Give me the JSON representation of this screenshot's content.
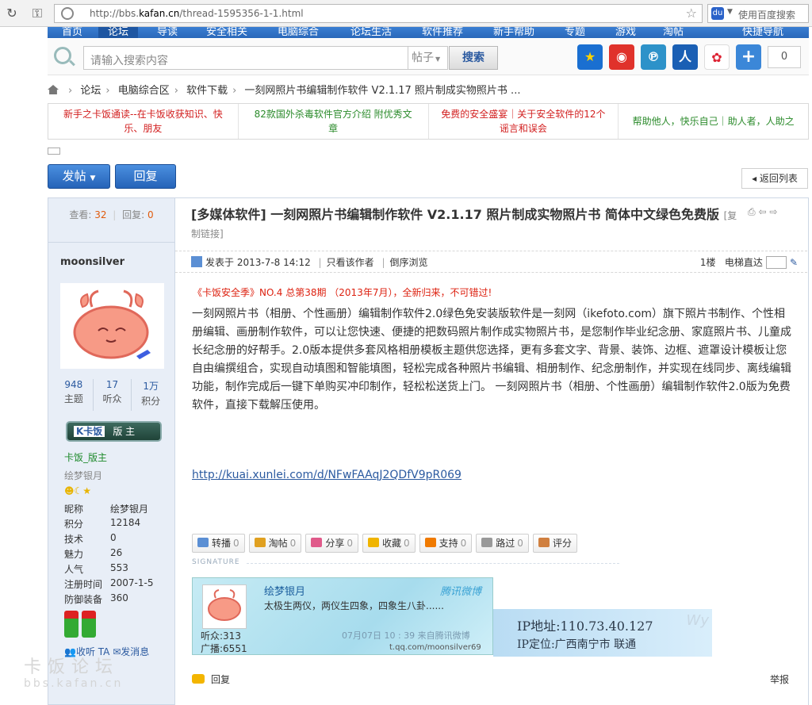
{
  "browser": {
    "url_scheme": "http://bbs.",
    "url_host": "kafan.cn",
    "url_path": "/thread-1595356-1-1.html",
    "search_placeholder": "使用百度搜索"
  },
  "topnav": [
    "首页",
    "论坛",
    "导读",
    "安全相关",
    "电脑综合",
    "论坛生活",
    "软件推荐",
    "新手帮助",
    "专题",
    "游戏",
    "淘帖",
    "快捷导航"
  ],
  "site_search": {
    "placeholder": "请输入搜索内容",
    "type": "帖子",
    "button": "搜索",
    "share_count": "0"
  },
  "breadcrumb": [
    "论坛",
    "电脑综合区",
    "软件下载",
    "一刻网照片书编辑制作软件 V2.1.17 照片制成实物照片书 ..."
  ],
  "ads": [
    {
      "text": "新手之卡饭通读--在卡饭收获知识、快乐、朋友",
      "color": "#d21f1f"
    },
    {
      "text": "82款国外杀毒软件官方介绍 附优秀文章",
      "color": "#2a8a2a"
    },
    {
      "text": "免费的安全盛宴｜关于安全软件的12个谣言和误会",
      "color": "#d21f1f"
    },
    {
      "text": "帮助他人，快乐自己｜助人者，人助之",
      "color": "#2a8a2a"
    }
  ],
  "buttons": {
    "post": "发帖",
    "reply": "回复",
    "back_to_list": "返回列表"
  },
  "thread": {
    "views_label": "查看:",
    "views": "32",
    "replies_label": "回复:",
    "replies": "0",
    "title": "[多媒体软件] 一刻网照片书编辑制作软件 V2.1.17 照片制成实物照片书 简体中文绿色免费版",
    "copy_link": "[复制链接]"
  },
  "author": {
    "name": "moonsilver",
    "stats": [
      {
        "num": "948",
        "label": "主题"
      },
      {
        "num": "17",
        "label": "听众"
      },
      {
        "num": "1万",
        "label": "积分"
      }
    ],
    "badge_logo": "K卡饭",
    "badge_role": "版 主",
    "rank": "卡饭_版主",
    "nickname_shown": "绘梦银月",
    "info": [
      {
        "k": "昵称",
        "v": "绘梦银月"
      },
      {
        "k": "积分",
        "v": "12184"
      },
      {
        "k": "技术",
        "v": "0"
      },
      {
        "k": "魅力",
        "v": "26"
      },
      {
        "k": "人气",
        "v": "553"
      },
      {
        "k": "注册时间",
        "v": "2007-1-5"
      },
      {
        "k": "防御装备",
        "v": "360"
      }
    ],
    "listen_label": "收听 TA",
    "message_label": "发消息"
  },
  "post": {
    "posted_label": "发表于",
    "posted_at": "2013-7-8 14:12",
    "only_author": "只看该作者",
    "reverse": "倒序浏览",
    "floor": "1楼",
    "jump_label": "电梯直达",
    "promo": "《卡饭安全季》NO.4 总第38期 （2013年7月），全新归来，不可错过!",
    "body": "一刻网照片书（相册、个性画册）编辑制作软件2.0绿色免安装版软件是一刻网（ikefoto.com）旗下照片书制作、个性相册编辑、画册制作软件，可以让您快速、便捷的把数码照片制作成实物照片书，是您制作毕业纪念册、家庭照片书、儿童成长纪念册的好帮手。2.0版本提供多套风格相册模板主题供您选择，更有多套文字、背景、装饰、边框、遮罩设计模板让您自由编撰组合，实现自动填图和智能填图，轻松完成各种照片书编辑、相册制作、纪念册制作，并实现在线同步、离线编辑功能，制作完成后一键下单购买冲印制作，轻松松送货上门。 一刻网照片书（相册、个性画册）编辑制作软件2.0版为免费软件，直接下载解压使用。",
    "link": "http://kuai.xunlei.com/d/NFwFAAqJ2QDfV9pR069"
  },
  "actions": [
    {
      "label": "转播",
      "count": "0",
      "color": "#5b8fd4"
    },
    {
      "label": "淘帖",
      "count": "0",
      "color": "#e0a020"
    },
    {
      "label": "分享",
      "count": "0",
      "color": "#e05a8a"
    },
    {
      "label": "收藏",
      "count": "0",
      "color": "#f0b400"
    },
    {
      "label": "支持",
      "count": "0",
      "color": "#f07a00"
    },
    {
      "label": "路过",
      "count": "0",
      "color": "#999999"
    },
    {
      "label": "评分",
      "count": "",
      "color": "#d08040"
    }
  ],
  "signature": {
    "label": "SIGNATURE",
    "name": "绘梦银月",
    "brand": "腾讯微博",
    "text": "太极生两仪，两仪生四象，四象生八卦......",
    "listeners": "听众:313",
    "broadcasts": "广播:6551",
    "date": "07月07日  10 : 39 来自腾讯微博",
    "qq": "t.qq.com/moonsilver69",
    "ip": "IP地址:110.73.40.127",
    "ip_loc": "IP定位:广西南宁市 联通",
    "ip_logo": "Wy"
  },
  "footer": {
    "reply": "回复",
    "report": "举报"
  },
  "watermark": {
    "main": "卡饭论坛",
    "sub": "bbs.kafan.cn"
  }
}
